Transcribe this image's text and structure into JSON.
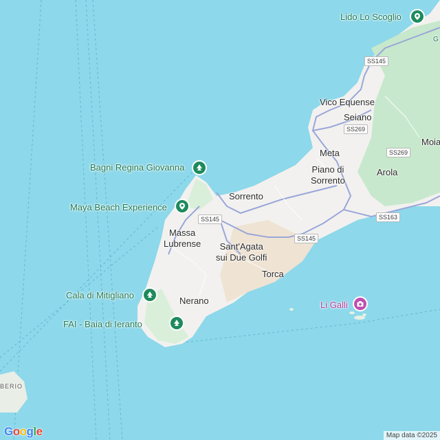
{
  "map": {
    "towns": {
      "sorrento": "Sorrento",
      "massa_lubrense": "Massa\nLubrense",
      "santagata": "Sant'Agata\nsui Due Golfi",
      "torca": "Torca",
      "nerano": "Nerano",
      "meta": "Meta",
      "piano_di_sorrento": "Piano di\nSorrento",
      "arola": "Arola",
      "vico_equense": "Vico Equense",
      "seiano": "Seiano",
      "moiano": "Moia",
      "tiberio": "BERIO"
    },
    "pois": {
      "lido_lo_scoglio": "Lido Lo Scoglio",
      "bagni_regina_giovanna": "Bagni Regina Giovanna",
      "maya_beach": "Maya Beach Experience",
      "cala_di_mitigliano": "Cala di Mitigliano",
      "fai_baia_di_ieranto": "FAI - Baia di Ieranto",
      "li_galli": "Li Galli"
    },
    "road_shields": [
      "SS145",
      "SS145",
      "SS145",
      "SS269",
      "SS269",
      "SS163"
    ],
    "edge_letter": "G",
    "icons": {
      "park": "tree-icon",
      "beach": "pin-circle-icon",
      "camera": "camera-icon"
    },
    "colors": {
      "sea": "#8dd8ea",
      "land": "#f2f1ef",
      "forest": "#c7e8cc",
      "roads": "#9aa6d9",
      "poi_green": "#1e8a5e",
      "poi_pink": "#c04db0"
    }
  },
  "footer": {
    "google_logo": "Google",
    "attribution": "Map data ©2025"
  }
}
